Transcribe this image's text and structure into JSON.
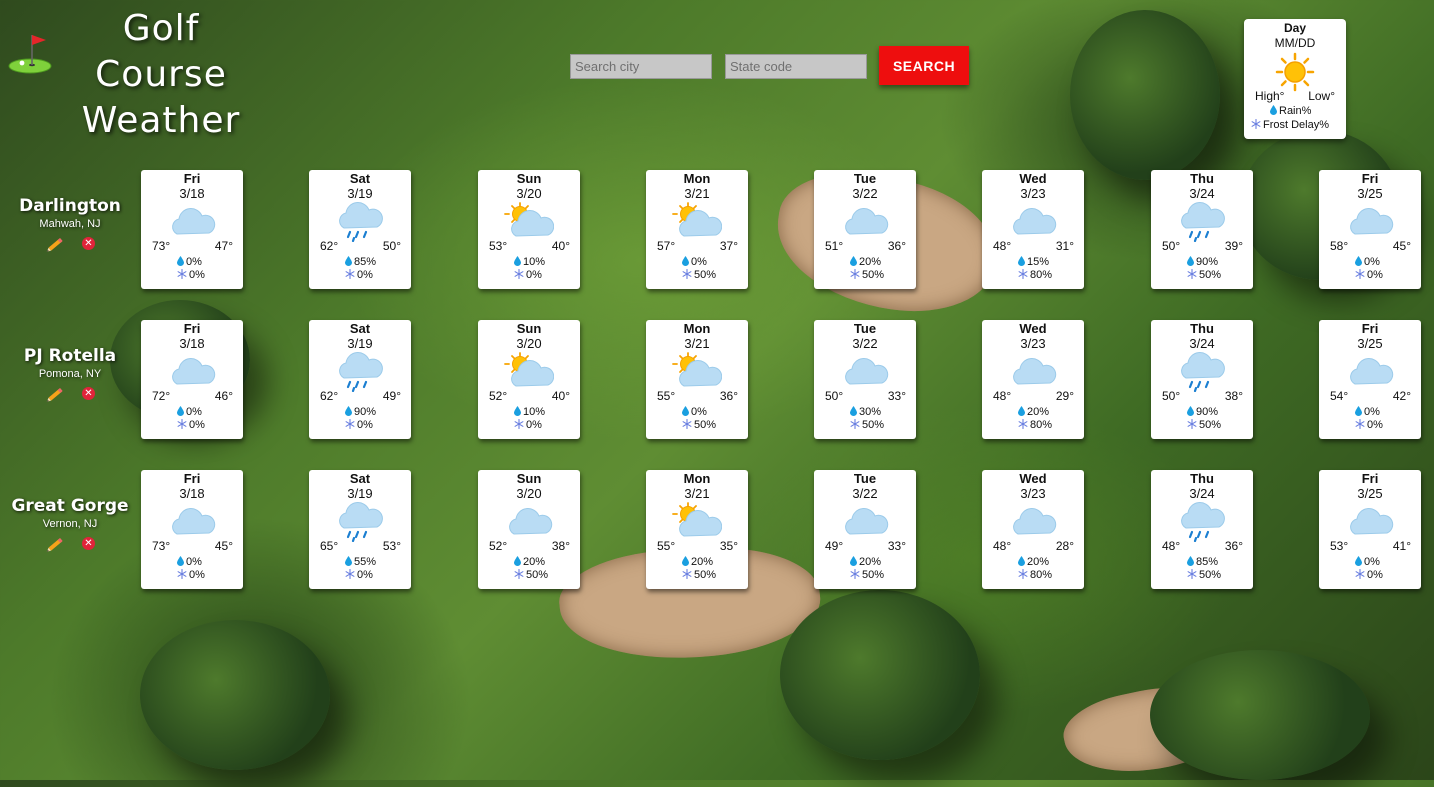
{
  "app": {
    "title_line1": "Golf Course",
    "title_line2": "Weather"
  },
  "search": {
    "city_placeholder": "Search city",
    "state_placeholder": "State code",
    "button_label": "SEARCH"
  },
  "legend": {
    "day": "Day",
    "date": "MM/DD",
    "icon": "sunny-icon",
    "high": "High°",
    "low": "Low°",
    "rain": "Rain%",
    "frost": "Frost Delay%"
  },
  "colors": {
    "search_button": "#ee0e0e",
    "delete_icon": "#e0243a",
    "card_bg": "#ffffff"
  },
  "courses": [
    {
      "name": "Darlington",
      "location": "Mahwah, NJ",
      "forecast": [
        {
          "day": "Fri",
          "date": "3/18",
          "icon": "cloudy",
          "high": "73°",
          "low": "47°",
          "rain": "0%",
          "frost": "0%"
        },
        {
          "day": "Sat",
          "date": "3/19",
          "icon": "rain",
          "high": "62°",
          "low": "50°",
          "rain": "85%",
          "frost": "0%"
        },
        {
          "day": "Sun",
          "date": "3/20",
          "icon": "partly-sunny",
          "high": "53°",
          "low": "40°",
          "rain": "10%",
          "frost": "0%"
        },
        {
          "day": "Mon",
          "date": "3/21",
          "icon": "partly-sunny",
          "high": "57°",
          "low": "37°",
          "rain": "0%",
          "frost": "50%"
        },
        {
          "day": "Tue",
          "date": "3/22",
          "icon": "cloudy",
          "high": "51°",
          "low": "36°",
          "rain": "20%",
          "frost": "50%"
        },
        {
          "day": "Wed",
          "date": "3/23",
          "icon": "cloudy",
          "high": "48°",
          "low": "31°",
          "rain": "15%",
          "frost": "80%"
        },
        {
          "day": "Thu",
          "date": "3/24",
          "icon": "rain",
          "high": "50°",
          "low": "39°",
          "rain": "90%",
          "frost": "50%"
        },
        {
          "day": "Fri",
          "date": "3/25",
          "icon": "cloudy",
          "high": "58°",
          "low": "45°",
          "rain": "0%",
          "frost": "0%"
        }
      ]
    },
    {
      "name": "PJ Rotella",
      "location": "Pomona, NY",
      "forecast": [
        {
          "day": "Fri",
          "date": "3/18",
          "icon": "cloudy",
          "high": "72°",
          "low": "46°",
          "rain": "0%",
          "frost": "0%"
        },
        {
          "day": "Sat",
          "date": "3/19",
          "icon": "rain",
          "high": "62°",
          "low": "49°",
          "rain": "90%",
          "frost": "0%"
        },
        {
          "day": "Sun",
          "date": "3/20",
          "icon": "partly-sunny",
          "high": "52°",
          "low": "40°",
          "rain": "10%",
          "frost": "0%"
        },
        {
          "day": "Mon",
          "date": "3/21",
          "icon": "partly-sunny",
          "high": "55°",
          "low": "36°",
          "rain": "0%",
          "frost": "50%"
        },
        {
          "day": "Tue",
          "date": "3/22",
          "icon": "cloudy",
          "high": "50°",
          "low": "33°",
          "rain": "30%",
          "frost": "50%"
        },
        {
          "day": "Wed",
          "date": "3/23",
          "icon": "cloudy",
          "high": "48°",
          "low": "29°",
          "rain": "20%",
          "frost": "80%"
        },
        {
          "day": "Thu",
          "date": "3/24",
          "icon": "rain",
          "high": "50°",
          "low": "38°",
          "rain": "90%",
          "frost": "50%"
        },
        {
          "day": "Fri",
          "date": "3/25",
          "icon": "cloudy",
          "high": "54°",
          "low": "42°",
          "rain": "0%",
          "frost": "0%"
        }
      ]
    },
    {
      "name": "Great Gorge",
      "location": "Vernon, NJ",
      "forecast": [
        {
          "day": "Fri",
          "date": "3/18",
          "icon": "cloudy",
          "high": "73°",
          "low": "45°",
          "rain": "0%",
          "frost": "0%"
        },
        {
          "day": "Sat",
          "date": "3/19",
          "icon": "rain",
          "high": "65°",
          "low": "53°",
          "rain": "55%",
          "frost": "0%"
        },
        {
          "day": "Sun",
          "date": "3/20",
          "icon": "cloudy",
          "high": "52°",
          "low": "38°",
          "rain": "20%",
          "frost": "50%"
        },
        {
          "day": "Mon",
          "date": "3/21",
          "icon": "partly-sunny",
          "high": "55°",
          "low": "35°",
          "rain": "20%",
          "frost": "50%"
        },
        {
          "day": "Tue",
          "date": "3/22",
          "icon": "cloudy",
          "high": "49°",
          "low": "33°",
          "rain": "20%",
          "frost": "50%"
        },
        {
          "day": "Wed",
          "date": "3/23",
          "icon": "cloudy",
          "high": "48°",
          "low": "28°",
          "rain": "20%",
          "frost": "80%"
        },
        {
          "day": "Thu",
          "date": "3/24",
          "icon": "rain",
          "high": "48°",
          "low": "36°",
          "rain": "85%",
          "frost": "50%"
        },
        {
          "day": "Fri",
          "date": "3/25",
          "icon": "cloudy",
          "high": "53°",
          "low": "41°",
          "rain": "0%",
          "frost": "0%"
        }
      ]
    }
  ]
}
